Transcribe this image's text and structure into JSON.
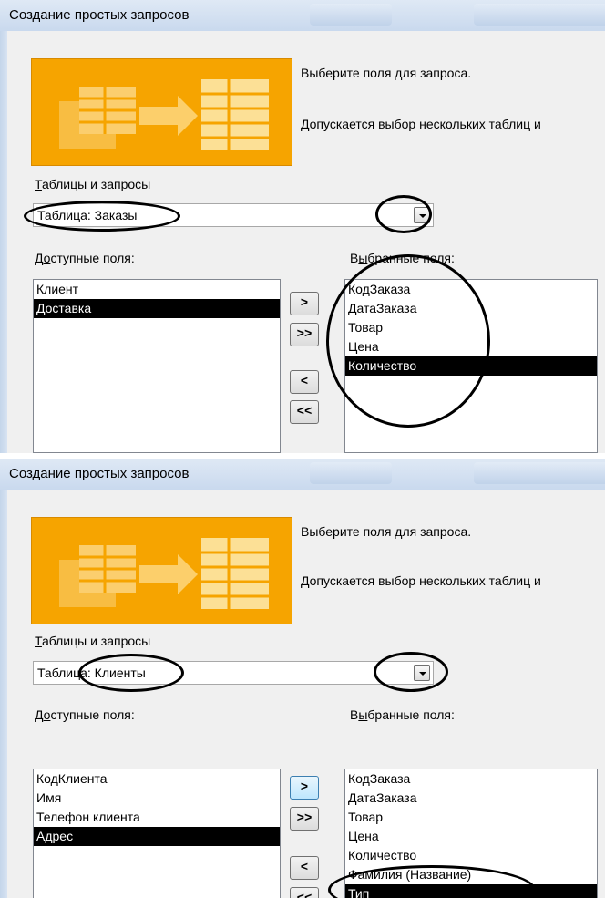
{
  "dialogs": [
    {
      "title": "Создание простых запросов",
      "instruction1": "Выберите поля для запроса.",
      "instruction2": "Допускается выбор нескольких таблиц и",
      "tables_label_u": "Т",
      "tables_label_rest": "аблицы и запросы",
      "table_value": "Таблица: Заказы",
      "available_label_pre": "Д",
      "available_label_u": "о",
      "available_label_rest": "ступные поля:",
      "selected_label_pre": "В",
      "selected_label_u": "ы",
      "selected_label_rest": "бранные поля:",
      "available_fields": [
        "Клиент",
        "Доставка"
      ],
      "selected_fields": [
        "КодЗаказа",
        "ДатаЗаказа",
        "Товар",
        "Цена",
        "Количество"
      ],
      "buttons": {
        "add": ">",
        "add_all": ">>",
        "remove": "<",
        "remove_all": "<<"
      }
    },
    {
      "title": "Создание простых запросов",
      "instruction1": "Выберите поля для запроса.",
      "instruction2": "Допускается выбор нескольких таблиц и",
      "tables_label_u": "Т",
      "tables_label_rest": "аблицы и запросы",
      "table_value": "Таблица: Клиенты",
      "available_label_pre": "Д",
      "available_label_u": "о",
      "available_label_rest": "ступные поля:",
      "selected_label_pre": "В",
      "selected_label_u": "ы",
      "selected_label_rest": "бранные поля:",
      "available_fields": [
        "КодКлиента",
        "Имя",
        "Телефон клиента",
        "Адрес"
      ],
      "selected_fields": [
        "КодЗаказа",
        "ДатаЗаказа",
        "Товар",
        "Цена",
        "Количество",
        "Фамилия (Название)",
        "Тип"
      ],
      "buttons": {
        "add": ">",
        "add_all": ">>",
        "remove": "<",
        "remove_all": "<<"
      }
    }
  ],
  "colors": {
    "graphic": "#f6a400",
    "selection": "#000000",
    "dialog_bg": "#f0f0f0",
    "titlebar": "#c9d9ee"
  }
}
